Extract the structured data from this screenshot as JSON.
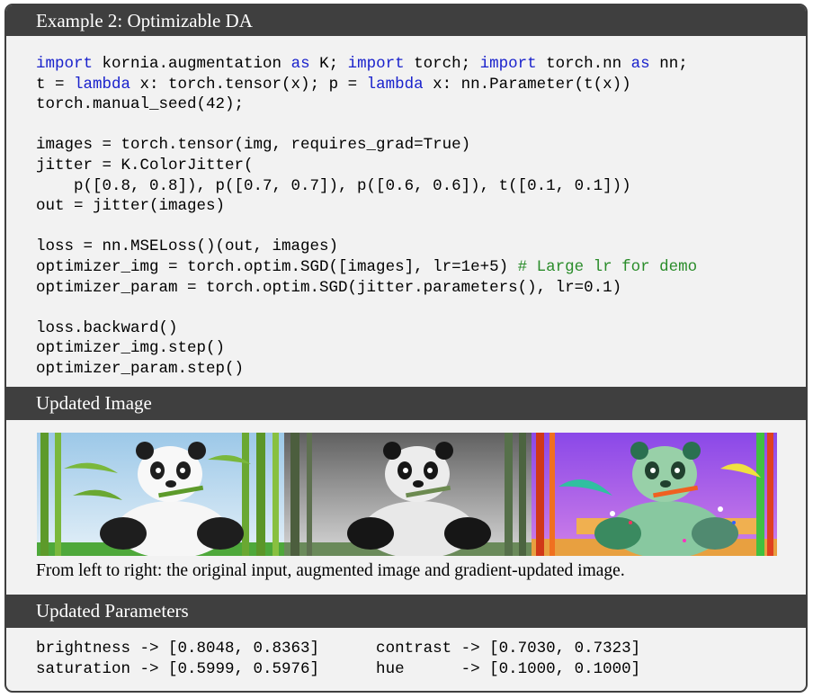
{
  "example": {
    "title": "Example 2: Optimizable DA"
  },
  "code": {
    "lines": [
      [
        {
          "t": "import",
          "c": "kw"
        },
        {
          "t": " kornia.augmentation "
        },
        {
          "t": "as",
          "c": "kw"
        },
        {
          "t": " K; "
        },
        {
          "t": "import",
          "c": "kw"
        },
        {
          "t": " torch; "
        },
        {
          "t": "import",
          "c": "kw"
        },
        {
          "t": " torch.nn "
        },
        {
          "t": "as",
          "c": "kw"
        },
        {
          "t": " nn;"
        }
      ],
      [
        {
          "t": "t = "
        },
        {
          "t": "lambda",
          "c": "kw"
        },
        {
          "t": " x: torch.tensor(x); p = "
        },
        {
          "t": "lambda",
          "c": "kw"
        },
        {
          "t": " x: nn.Parameter(t(x))"
        }
      ],
      [
        {
          "t": "torch.manual_seed(42);"
        }
      ],
      [],
      [
        {
          "t": "images = torch.tensor(img, requires_grad=True)"
        }
      ],
      [
        {
          "t": "jitter = K.ColorJitter("
        }
      ],
      [
        {
          "t": "    p([0.8, 0.8]), p([0.7, 0.7]), p([0.6, 0.6]), t([0.1, 0.1]))"
        }
      ],
      [
        {
          "t": "out = jitter(images)"
        }
      ],
      [],
      [
        {
          "t": "loss = nn.MSELoss()(out, images)"
        }
      ],
      [
        {
          "t": "optimizer_img = torch.optim.SGD([images], lr=1e+5) "
        },
        {
          "t": "# Large lr for demo",
          "c": "cm"
        }
      ],
      [
        {
          "t": "optimizer_param = torch.optim.SGD(jitter.parameters(), lr=0.1)"
        }
      ],
      [],
      [
        {
          "t": "loss.backward()"
        }
      ],
      [
        {
          "t": "optimizer_img.step()"
        }
      ],
      [
        {
          "t": "optimizer_param.step()"
        }
      ]
    ]
  },
  "updated_image": {
    "title": "Updated Image",
    "caption": "From left to right: the original input, augmented image and gradient-updated image."
  },
  "updated_parameters": {
    "title": "Updated Parameters",
    "line1": "brightness -> [0.8048, 0.8363]      contrast -> [0.7030, 0.7323]",
    "line2": "saturation -> [0.5999, 0.5976]      hue      -> [0.1000, 0.1000]"
  },
  "colors": {
    "keyword": "#1a22cc",
    "comment": "#2a8c2a",
    "header_bg": "#3f3f3f",
    "body_bg": "#f2f2f2"
  }
}
